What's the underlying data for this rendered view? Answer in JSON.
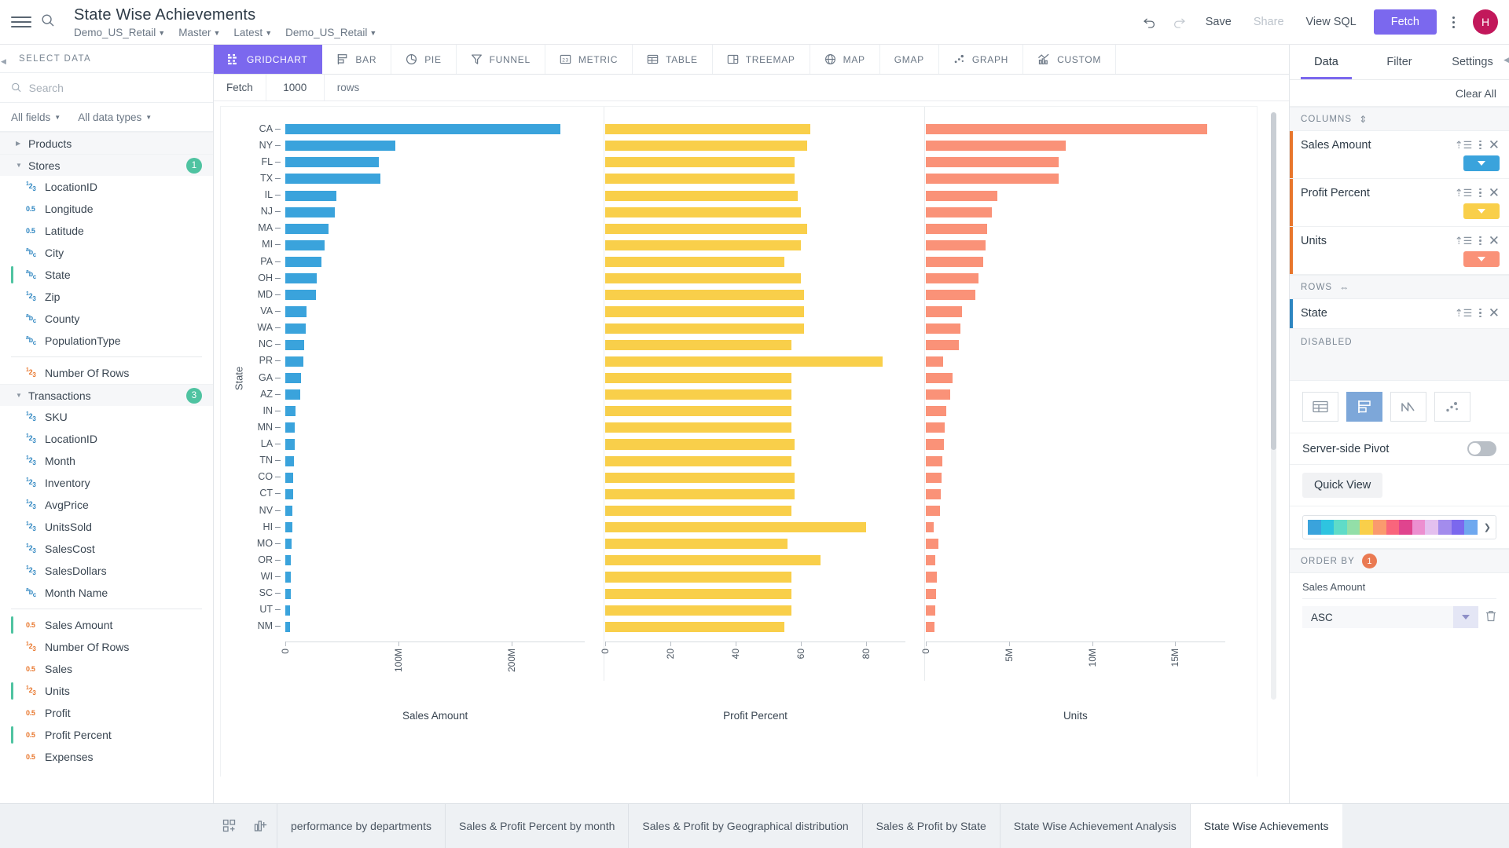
{
  "header": {
    "title": "State Wise Achievements",
    "breadcrumbs": [
      {
        "label": "Demo_US_Retail"
      },
      {
        "label": "Master"
      },
      {
        "label": "Latest"
      },
      {
        "label": "Demo_US_Retail"
      }
    ],
    "actions": {
      "undo": "undo-icon",
      "redo": "redo-icon",
      "save": "Save",
      "share": "Share",
      "view_sql": "View SQL",
      "fetch": "Fetch",
      "avatar_initial": "H"
    }
  },
  "left_panel": {
    "heading": "SELECT DATA",
    "search_placeholder": "Search",
    "search_value": "",
    "filters": [
      {
        "label": "All fields"
      },
      {
        "label": "All data types"
      }
    ],
    "groups": [
      {
        "label": "Products",
        "expanded": false,
        "badge": "",
        "fields": []
      },
      {
        "label": "Stores",
        "expanded": true,
        "badge": "1",
        "fields": [
          {
            "label": "LocationID",
            "type": "int",
            "selected": false
          },
          {
            "label": "Longitude",
            "type": "dec",
            "selected": false
          },
          {
            "label": "Latitude",
            "type": "dec",
            "selected": false
          },
          {
            "label": "City",
            "type": "text",
            "selected": false
          },
          {
            "label": "State",
            "type": "text",
            "selected": true
          },
          {
            "label": "Zip",
            "type": "int",
            "selected": false
          },
          {
            "label": "County",
            "type": "text",
            "selected": false
          },
          {
            "label": "PopulationType",
            "type": "text",
            "selected": false
          },
          {
            "label": "",
            "type": "divider",
            "selected": false
          },
          {
            "label": "Number Of Rows",
            "type": "int-measure",
            "selected": false
          }
        ]
      },
      {
        "label": "Transactions",
        "expanded": true,
        "badge": "3",
        "fields": [
          {
            "label": "SKU",
            "type": "int",
            "selected": false
          },
          {
            "label": "LocationID",
            "type": "int",
            "selected": false
          },
          {
            "label": "Month",
            "type": "int",
            "selected": false
          },
          {
            "label": "Inventory",
            "type": "int",
            "selected": false
          },
          {
            "label": "AvgPrice",
            "type": "int",
            "selected": false
          },
          {
            "label": "UnitsSold",
            "type": "int",
            "selected": false
          },
          {
            "label": "SalesCost",
            "type": "int",
            "selected": false
          },
          {
            "label": "SalesDollars",
            "type": "int",
            "selected": false
          },
          {
            "label": "Month Name",
            "type": "text",
            "selected": false
          },
          {
            "label": "",
            "type": "divider",
            "selected": false
          },
          {
            "label": "Sales Amount",
            "type": "dec-measure",
            "selected": true
          },
          {
            "label": "Number Of Rows",
            "type": "int-measure",
            "selected": false
          },
          {
            "label": "Sales",
            "type": "dec-measure",
            "selected": false
          },
          {
            "label": "Units",
            "type": "int-measure",
            "selected": true
          },
          {
            "label": "Profit",
            "type": "dec-measure",
            "selected": false
          },
          {
            "label": "Profit Percent",
            "type": "dec-measure",
            "selected": true
          },
          {
            "label": "Expenses",
            "type": "dec-measure",
            "selected": false
          }
        ]
      }
    ]
  },
  "chart_tabs": [
    {
      "label": "GRIDCHART",
      "icon": "gridchart-icon",
      "active": true
    },
    {
      "label": "BAR",
      "icon": "bar-icon",
      "active": false
    },
    {
      "label": "PIE",
      "icon": "pie-icon",
      "active": false
    },
    {
      "label": "FUNNEL",
      "icon": "funnel-icon",
      "active": false
    },
    {
      "label": "METRIC",
      "icon": "metric-icon",
      "active": false
    },
    {
      "label": "TABLE",
      "icon": "table-icon",
      "active": false
    },
    {
      "label": "TREEMAP",
      "icon": "treemap-icon",
      "active": false
    },
    {
      "label": "MAP",
      "icon": "map-icon",
      "active": false
    },
    {
      "label": "GMAP",
      "icon": "gmap-icon",
      "active": false
    },
    {
      "label": "GRAPH",
      "icon": "graph-icon",
      "active": false
    },
    {
      "label": "CUSTOM",
      "icon": "custom-icon",
      "active": false
    }
  ],
  "fetch_row": {
    "fetch_label": "Fetch",
    "rows_value": "1000",
    "rows_label": "rows"
  },
  "right_panel": {
    "tabs": [
      {
        "label": "Data",
        "active": true
      },
      {
        "label": "Filter",
        "active": false
      },
      {
        "label": "Settings",
        "active": false
      }
    ],
    "clear_all": "Clear All",
    "columns_heading": "COLUMNS",
    "columns": [
      {
        "label": "Sales Amount",
        "accent": "#e8762c",
        "color": "#3aa3dc"
      },
      {
        "label": "Profit Percent",
        "accent": "#e8762c",
        "color": "#f9cf4a"
      },
      {
        "label": "Units",
        "accent": "#e8762c",
        "color": "#fa9278"
      }
    ],
    "rows_heading": "ROWS",
    "rows": [
      {
        "label": "State",
        "accent": "#2e86c1"
      }
    ],
    "disabled_heading": "DISABLED",
    "viz_buttons": [
      {
        "name": "table-view-icon",
        "active": false
      },
      {
        "name": "bar-view-icon",
        "active": true
      },
      {
        "name": "line-view-icon",
        "active": false
      },
      {
        "name": "scatter-view-icon",
        "active": false
      }
    ],
    "pivot_label": "Server-side Pivot",
    "pivot_on": false,
    "quick_view": "Quick View",
    "palette": [
      "#3aa3dc",
      "#2ec4e0",
      "#5fdcc8",
      "#93dfa8",
      "#f9cf4a",
      "#fa9a6e",
      "#f9657c",
      "#e0448e",
      "#ec8fd0",
      "#e4c0ef",
      "#a38ced",
      "#7b68ee",
      "#6fa8ef"
    ],
    "order_by_heading": "ORDER BY",
    "order_by_badge": "1",
    "order_by": [
      {
        "field": "Sales Amount",
        "direction": "ASC"
      }
    ]
  },
  "bottom_tabs": [
    {
      "label": "performance by departments",
      "active": false
    },
    {
      "label": "Sales & Profit Percent by month",
      "active": false
    },
    {
      "label": "Sales & Profit by Geographical distribution",
      "active": false
    },
    {
      "label": "Sales & Profit by State",
      "active": false
    },
    {
      "label": "State Wise Achievement Analysis",
      "active": false
    },
    {
      "label": "State Wise Achievements",
      "active": true
    }
  ],
  "chart_data": {
    "type": "bar",
    "layout": "grid-of-3-horizontal-bar-panels",
    "title": "State Wise Achievements",
    "ylabel": "State",
    "sorted_by": "Sales Amount ASC",
    "categories": [
      "CA",
      "NY",
      "FL",
      "TX",
      "IL",
      "NJ",
      "MA",
      "MI",
      "PA",
      "OH",
      "MD",
      "VA",
      "WA",
      "NC",
      "PR",
      "GA",
      "AZ",
      "IN",
      "MN",
      "LA",
      "TN",
      "CO",
      "CT",
      "NV",
      "HI",
      "MO",
      "OR",
      "WI",
      "SC",
      "UT",
      "NM"
    ],
    "panels": [
      {
        "name": "Sales Amount",
        "color": "#3aa3dc",
        "xlabel": "Sales Amount",
        "xlim": [
          0,
          265000000
        ],
        "xticks": [
          0,
          100000000,
          200000000
        ],
        "xticklabels": [
          "0",
          "100M",
          "200M"
        ],
        "values": [
          243000000,
          97000000,
          83000000,
          84000000,
          45000000,
          44000000,
          38000000,
          35000000,
          32000000,
          28000000,
          27000000,
          19000000,
          18000000,
          17000000,
          16000000,
          14000000,
          13500000,
          9000000,
          8500000,
          8000000,
          7500000,
          7000000,
          6800000,
          6500000,
          6000000,
          5500000,
          5200000,
          5000000,
          4800000,
          4500000,
          4200000
        ]
      },
      {
        "name": "Profit Percent",
        "color": "#f9cf4a",
        "xlabel": "Profit Percent",
        "xlim": [
          0,
          92
        ],
        "xticks": [
          0,
          20,
          40,
          60,
          80
        ],
        "xticklabels": [
          "0",
          "20",
          "40",
          "60",
          "80"
        ],
        "values": [
          63,
          62,
          58,
          58,
          59,
          60,
          62,
          60,
          55,
          60,
          61,
          61,
          61,
          57,
          85,
          57,
          57,
          57,
          57,
          58,
          57,
          58,
          58,
          57,
          80,
          56,
          66,
          57,
          57,
          57,
          55
        ]
      },
      {
        "name": "Units",
        "color": "#fa9278",
        "xlabel": "Units",
        "xlim": [
          0,
          18000000
        ],
        "xticks": [
          0,
          5000000,
          10000000,
          15000000
        ],
        "xticklabels": [
          "0",
          "5M",
          "10M",
          "15M"
        ],
        "values": [
          16900000,
          8400000,
          8000000,
          8000000,
          4300000,
          4000000,
          3700000,
          3600000,
          3450000,
          3200000,
          3000000,
          2200000,
          2100000,
          2000000,
          1050000,
          1600000,
          1500000,
          1250000,
          1150000,
          1100000,
          1000000,
          950000,
          900000,
          850000,
          500000,
          780000,
          560000,
          700000,
          650000,
          600000,
          520000
        ]
      }
    ]
  }
}
